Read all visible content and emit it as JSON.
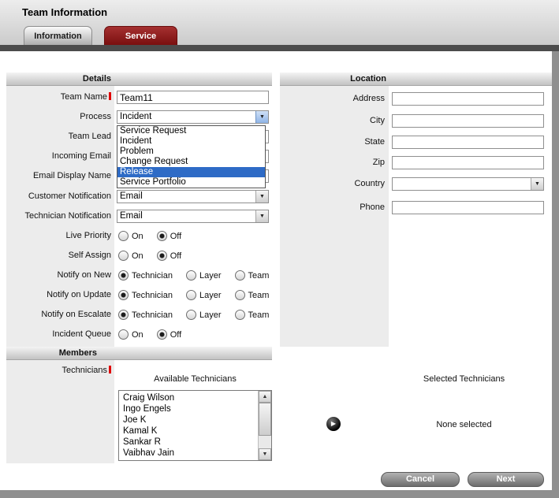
{
  "title": "Team Information",
  "tabs": {
    "information": "Information",
    "service": "Service"
  },
  "icons": {
    "dropdown_arrow": "▼",
    "scroll_up": "▲",
    "scroll_down": "▼",
    "move_right": "▶"
  },
  "details": {
    "header": "Details",
    "team_name": {
      "label": "Team Name",
      "required": true,
      "value": "Team11"
    },
    "process": {
      "label": "Process",
      "value": "Incident",
      "options": [
        "Service Request",
        "Incident",
        "Problem",
        "Change Request",
        "Release",
        "Service Portfolio"
      ],
      "highlighted_option": "Release"
    },
    "team_lead": {
      "label": "Team Lead"
    },
    "incoming_email": {
      "label": "Incoming Email"
    },
    "email_display_name": {
      "label": "Email Display Name"
    },
    "customer_notification": {
      "label": "Customer Notification",
      "value": "Email"
    },
    "technician_notification": {
      "label": "Technician Notification",
      "value": "Email"
    },
    "live_priority": {
      "label": "Live Priority",
      "options": [
        "On",
        "Off"
      ],
      "selected": "Off"
    },
    "self_assign": {
      "label": "Self Assign",
      "options": [
        "On",
        "Off"
      ],
      "selected": "Off"
    },
    "notify_on_new": {
      "label": "Notify on New",
      "options": [
        "Technician",
        "Layer",
        "Team"
      ],
      "selected": "Technician"
    },
    "notify_on_update": {
      "label": "Notify on Update",
      "options": [
        "Technician",
        "Layer",
        "Team"
      ],
      "selected": "Technician"
    },
    "notify_on_escalate": {
      "label": "Notify on Escalate",
      "options": [
        "Technician",
        "Layer",
        "Team"
      ],
      "selected": "Technician"
    },
    "incident_queue": {
      "label": "Incident Queue",
      "options": [
        "On",
        "Off"
      ],
      "selected": "Off"
    }
  },
  "location": {
    "header": "Location",
    "address": {
      "label": "Address"
    },
    "city": {
      "label": "City"
    },
    "state": {
      "label": "State"
    },
    "zip": {
      "label": "Zip"
    },
    "country": {
      "label": "Country"
    },
    "phone": {
      "label": "Phone"
    }
  },
  "members": {
    "header": "Members",
    "technicians_label": "Technicians",
    "technicians_required": true,
    "available_label": "Available Technicians",
    "selected_label": "Selected Technicians",
    "available_technicians": [
      "Craig Wilson",
      "Ingo Engels",
      "Joe K",
      "Kamal K",
      "Sankar R",
      "Vaibhav Jain"
    ],
    "selected_placeholder": "None selected"
  },
  "actions": {
    "cancel": "Cancel",
    "next": "Next"
  },
  "colors": {
    "tab_red": "#8e1a1a",
    "selection_blue": "#2e6bc6",
    "required_red": "#e00000"
  }
}
